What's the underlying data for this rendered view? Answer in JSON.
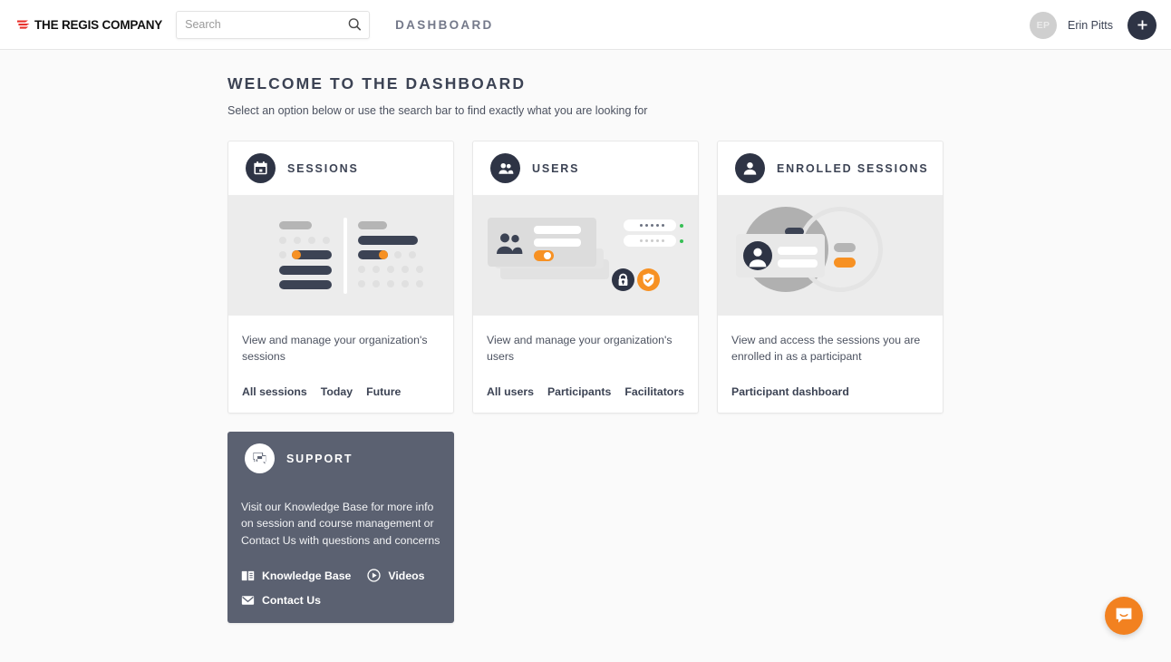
{
  "brand": {
    "logo_text": "THE REGIS COMPANY",
    "logo_mark_color": "#e8312b",
    "accent_orange": "#f79123",
    "accent_navy": "#2e3445",
    "support_bg": "#5b6171"
  },
  "header": {
    "search": {
      "value": "",
      "placeholder": "Search",
      "icon": "search-icon"
    },
    "page_title": "DASHBOARD",
    "user": {
      "initials": "EP",
      "name": "Erin Pitts"
    },
    "add_button_label": "+"
  },
  "welcome": {
    "title": "WELCOME TO THE DASHBOARD",
    "subtitle": "Select an option below or use the search bar to find exactly what you are looking for"
  },
  "cards": [
    {
      "title": "SESSIONS",
      "icon": "calendar-icon",
      "description": "View and manage your organization's sessions",
      "links": [
        "All sessions",
        "Today",
        "Future"
      ]
    },
    {
      "title": "USERS",
      "icon": "users-icon",
      "description": "View and manage your organization's users",
      "links": [
        "All users",
        "Participants",
        "Facilitators"
      ]
    },
    {
      "title": "ENROLLED SESSIONS",
      "icon": "person-icon",
      "description": "View and access the sessions you are enrolled in as a participant",
      "links": [
        "Participant dashboard"
      ]
    }
  ],
  "support": {
    "title": "SUPPORT",
    "icon": "chat-icon",
    "description": "Visit our Knowledge Base for more info on session and course management or Contact Us with questions and concerns",
    "links": [
      {
        "label": "Knowledge Base",
        "icon": "book-icon"
      },
      {
        "label": "Videos",
        "icon": "play-circle-icon"
      },
      {
        "label": "Contact Us",
        "icon": "envelope-icon"
      }
    ]
  },
  "chat_widget": {
    "icon": "intercom-chat-icon",
    "color": "#f28120"
  }
}
